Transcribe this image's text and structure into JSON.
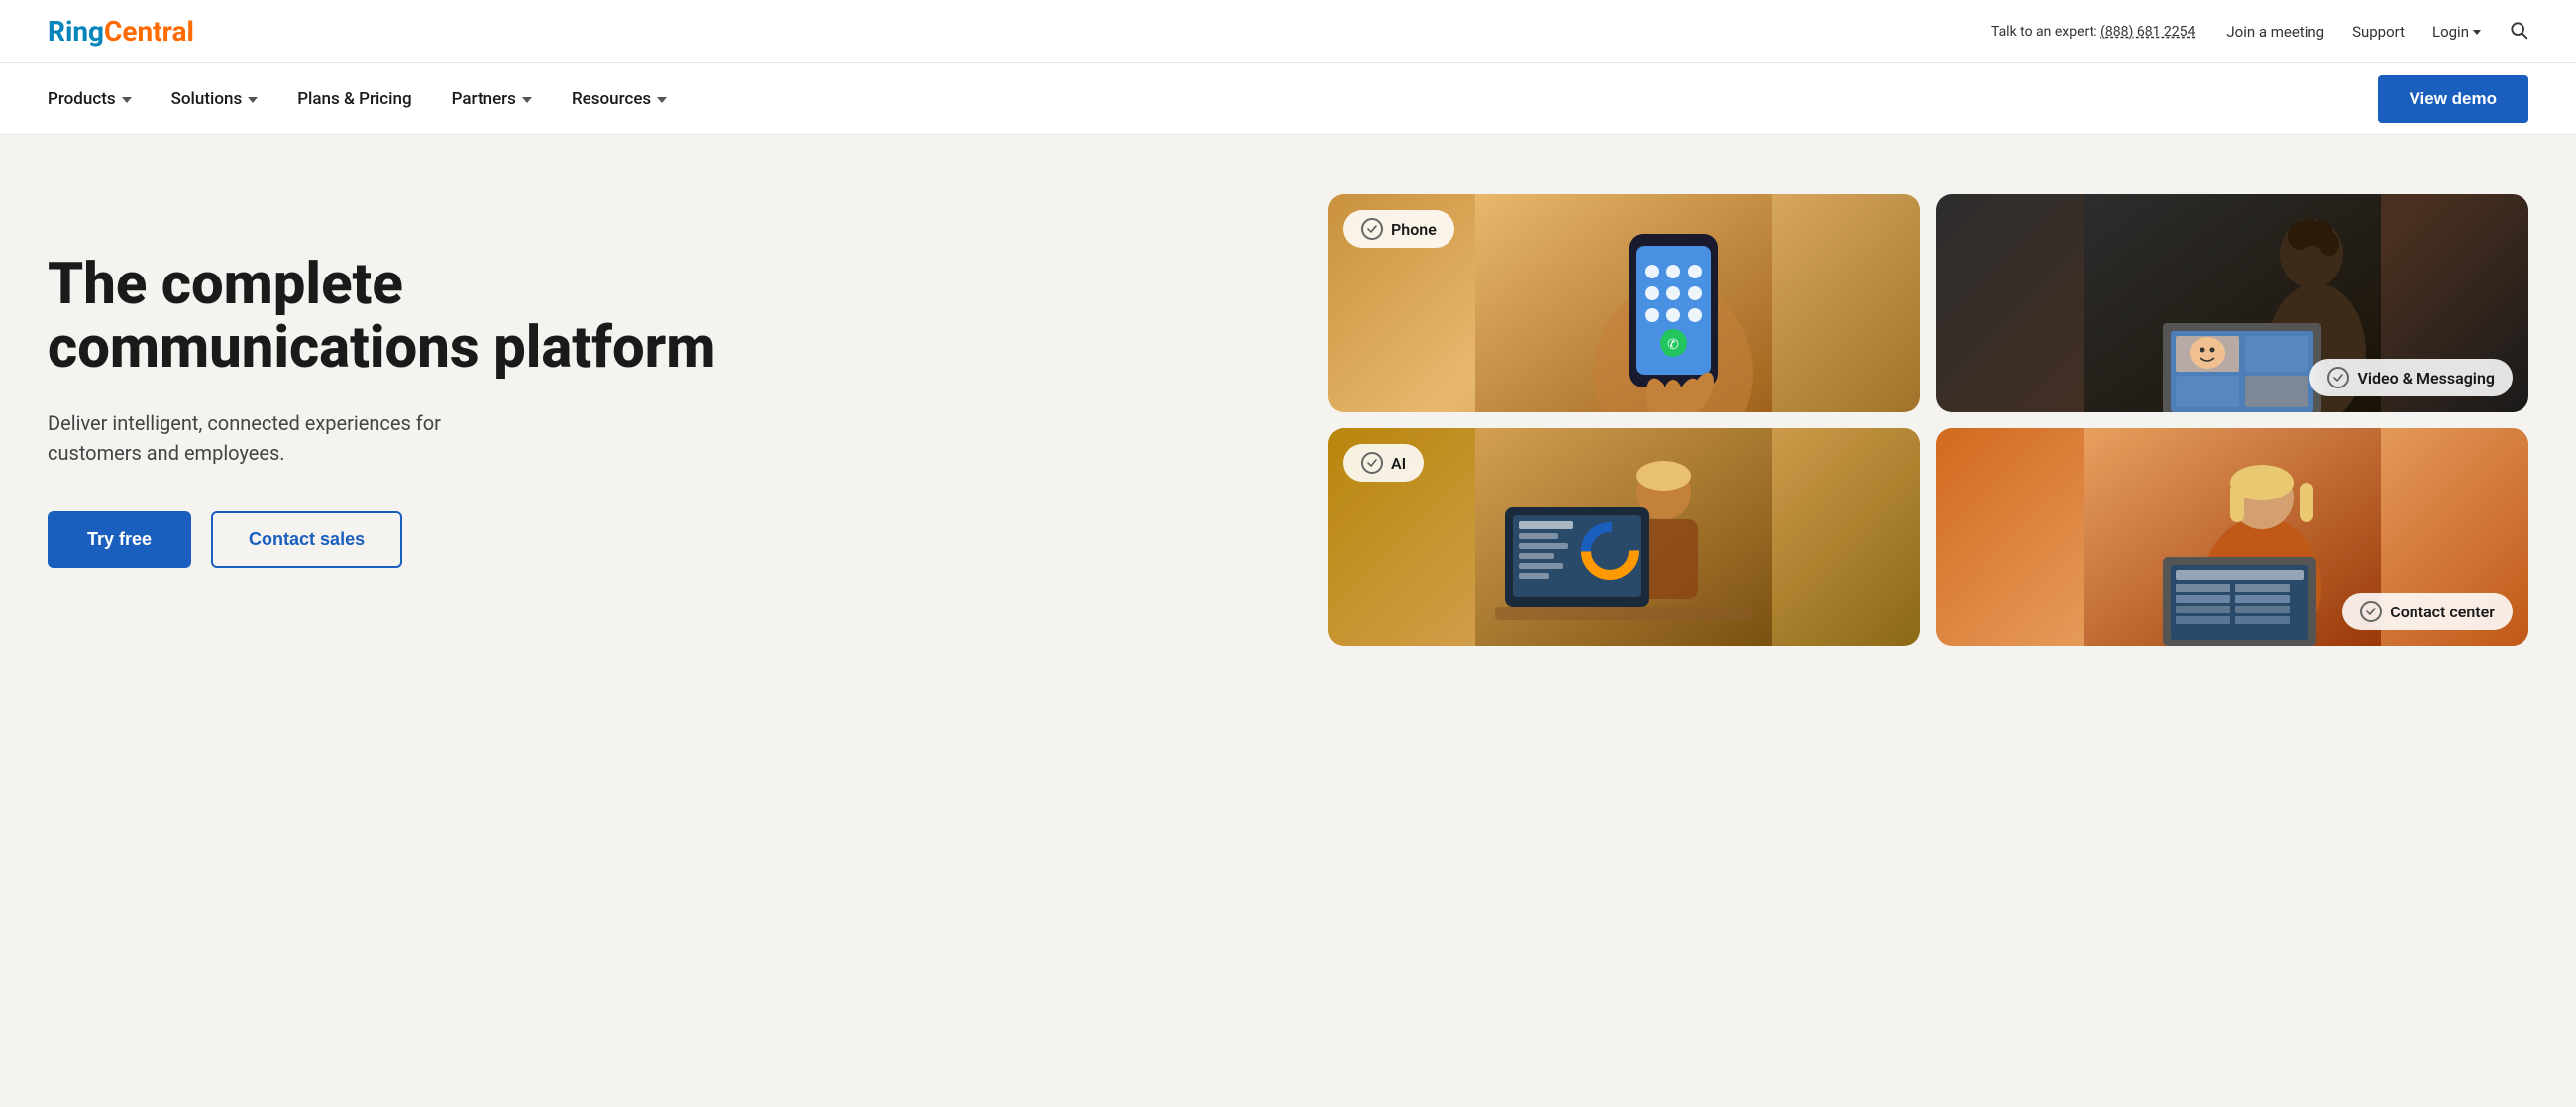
{
  "brand": {
    "ring": "Ring",
    "central": "Central"
  },
  "topbar": {
    "talk_to_expert": "Talk to an expert:",
    "phone": "(888) 681 2254",
    "join_meeting": "Join a meeting",
    "support": "Support",
    "login": "Login"
  },
  "nav": {
    "products": "Products",
    "solutions": "Solutions",
    "plans_pricing": "Plans & Pricing",
    "partners": "Partners",
    "resources": "Resources",
    "view_demo": "View demo"
  },
  "hero": {
    "title_line1": "The complete",
    "title_line2": "communications platform",
    "subtitle": "Deliver intelligent, connected experiences for customers and employees.",
    "try_free": "Try free",
    "contact_sales": "Contact sales"
  },
  "cards": [
    {
      "id": "phone",
      "label": "Phone",
      "position": "top-left"
    },
    {
      "id": "video",
      "label": "Video & Messaging",
      "position": "top-right"
    },
    {
      "id": "ai",
      "label": "AI",
      "position": "bottom-left"
    },
    {
      "id": "contact",
      "label": "Contact center",
      "position": "bottom-right"
    }
  ]
}
